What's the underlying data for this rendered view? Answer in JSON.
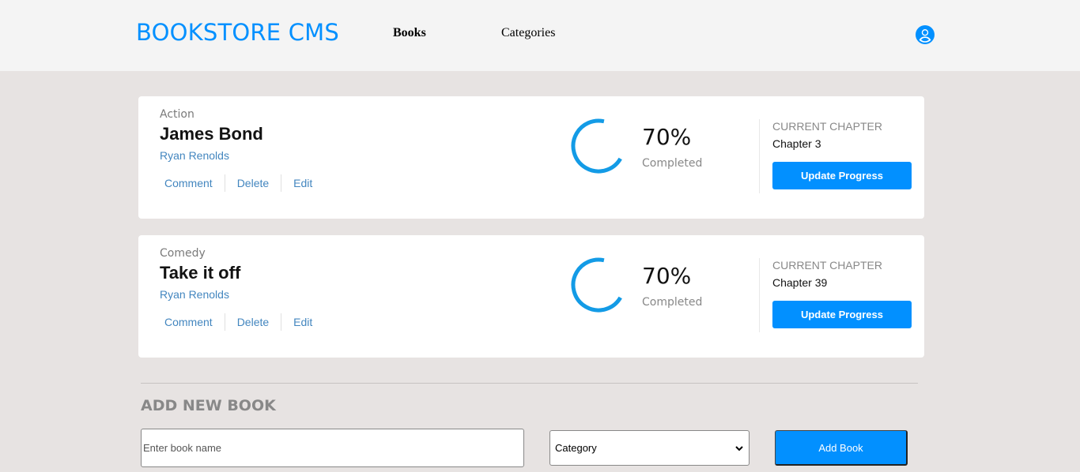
{
  "header": {
    "logo": "BOOKSTORE CMS",
    "nav": {
      "books": "Books",
      "categories": "Categories"
    },
    "user_icon": "user-circle-icon",
    "brand_color": "#0290ff"
  },
  "books": [
    {
      "genre": "Action",
      "title": "James Bond",
      "author": "Ryan Renolds",
      "actions": {
        "comment": "Comment",
        "delete": "Delete",
        "edit": "Edit"
      },
      "progress_value": 0.7,
      "percent": "70%",
      "completed_label": "Completed",
      "chapter_label": "CURRENT CHAPTER",
      "chapter": "Chapter 3",
      "update_label": "Update Progress"
    },
    {
      "genre": "Comedy",
      "title": "Take it off",
      "author": "Ryan Renolds",
      "actions": {
        "comment": "Comment",
        "delete": "Delete",
        "edit": "Edit"
      },
      "progress_value": 0.7,
      "percent": "70%",
      "completed_label": "Completed",
      "chapter_label": "CURRENT CHAPTER",
      "chapter": "Chapter 39",
      "update_label": "Update Progress"
    }
  ],
  "form": {
    "title": "ADD NEW BOOK",
    "name_placeholder": "Enter book name",
    "category_selected": "Category",
    "add_label": "Add Book"
  },
  "colors": {
    "accent": "#0290ff",
    "progress": "#139be6",
    "background": "#e7e3e2"
  }
}
